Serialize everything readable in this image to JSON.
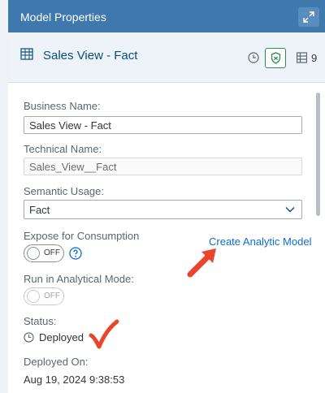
{
  "header": {
    "title": "Model Properties"
  },
  "subheader": {
    "title": "Sales View - Fact",
    "count": "9"
  },
  "fields": {
    "business_name": {
      "label": "Business Name:",
      "value": "Sales View - Fact"
    },
    "technical_name": {
      "label": "Technical Name:",
      "value": "Sales_View__Fact"
    },
    "semantic_usage": {
      "label": "Semantic Usage:",
      "value": "Fact"
    },
    "expose": {
      "label": "Expose for Consumption",
      "toggle": "OFF"
    },
    "create_link": "Create Analytic Model",
    "analytical_mode": {
      "label": "Run in Analytical Mode:",
      "toggle": "OFF"
    },
    "status": {
      "label": "Status:",
      "value": "Deployed"
    },
    "deployed_on": {
      "label": "Deployed On:",
      "value": "Aug 19, 2024 9:38:53"
    }
  },
  "icons": {
    "expand": "expand-icon",
    "view": "view-icon",
    "clock": "clock-icon",
    "shield": "shield-icon",
    "table": "table-icon",
    "help": "help-icon",
    "chevron": "chevron-down-icon"
  },
  "colors": {
    "header_bg": "#3f78ad",
    "subheader_bg": "#edf3f8",
    "link": "#0a6ed1",
    "shield": "#2e8b57",
    "annotation": "#e8452c"
  }
}
